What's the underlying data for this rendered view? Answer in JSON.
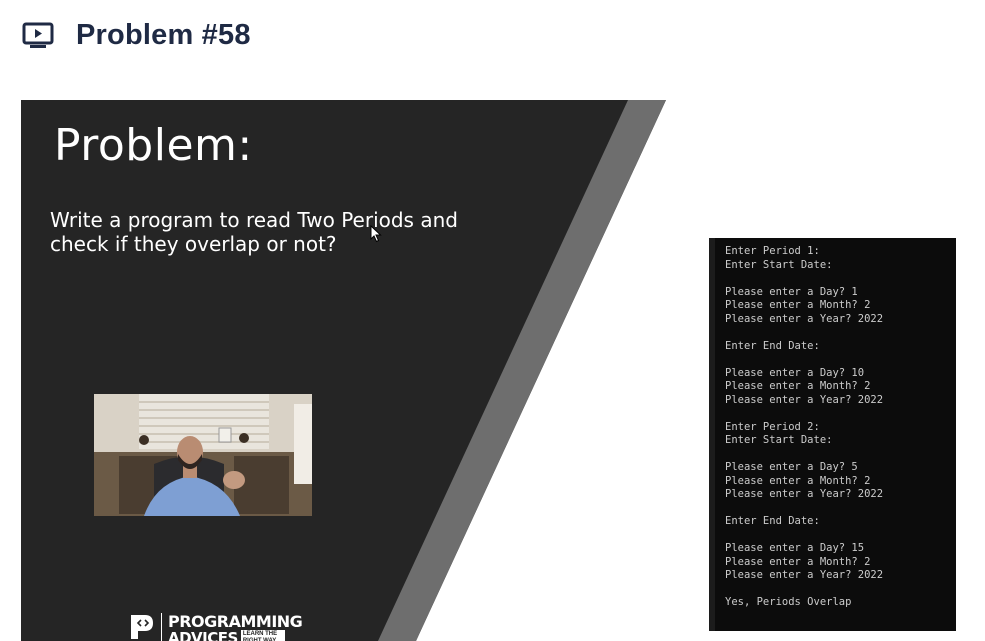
{
  "header": {
    "icon": "video-play-icon",
    "title": "Problem #58"
  },
  "slide": {
    "title": "Problem:",
    "body": "Write a program to read Two Periods and check if they overlap or not?",
    "logo": {
      "brand_line1": "PROGRAMMING",
      "brand_line2": "ADVICES",
      "tagline": "LEARN THE RIGHT WAY"
    },
    "colors": {
      "dark_panel": "#252525",
      "stripe": "#6e6e6e"
    }
  },
  "console": {
    "lines": [
      "Enter Period 1:",
      "Enter Start Date:",
      "",
      "Please enter a Day? 1",
      "Please enter a Month? 2",
      "Please enter a Year? 2022",
      "",
      "Enter End Date:",
      "",
      "Please enter a Day? 10",
      "Please enter a Month? 2",
      "Please enter a Year? 2022",
      "",
      "Enter Period 2:",
      "Enter Start Date:",
      "",
      "Please enter a Day? 5",
      "Please enter a Month? 2",
      "Please enter a Year? 2022",
      "",
      "Enter End Date:",
      "",
      "Please enter a Day? 15",
      "Please enter a Month? 2",
      "Please enter a Year? 2022",
      "",
      "Yes, Periods Overlap"
    ]
  }
}
